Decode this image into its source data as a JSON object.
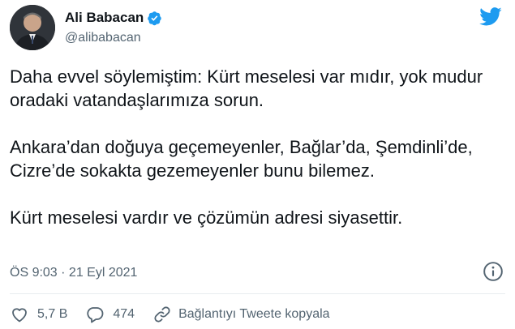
{
  "author": {
    "display_name": "Ali Babacan",
    "handle": "@alibabacan",
    "verified": true
  },
  "tweet": {
    "paragraphs": [
      "Daha evvel söylemiştim: Kürt meselesi var mıdır, yok mudur oradaki vatandaşlarımıza sorun.",
      "Ankara’dan doğuya geçemeyenler, Bağlar’da, Şemdinli’de, Cizre’de sokakta gezemeyenler bunu bilemez.",
      "Kürt meselesi vardır ve çözümün adresi siyasettir."
    ],
    "timestamp": "ÖS 9:03 · 21 Eyl 2021"
  },
  "actions": {
    "likes": "5,7 B",
    "replies": "474",
    "copy_link": "Bağlantıyı Tweete kopyala"
  },
  "colors": {
    "brand": "#1d9bf0",
    "text": "#0f1419",
    "secondary": "#536471"
  },
  "icons": {
    "logo": "twitter-bird-icon",
    "verified": "verified-badge-icon",
    "info": "info-icon",
    "like": "heart-icon",
    "reply": "reply-bubble-icon",
    "copy": "link-icon"
  }
}
